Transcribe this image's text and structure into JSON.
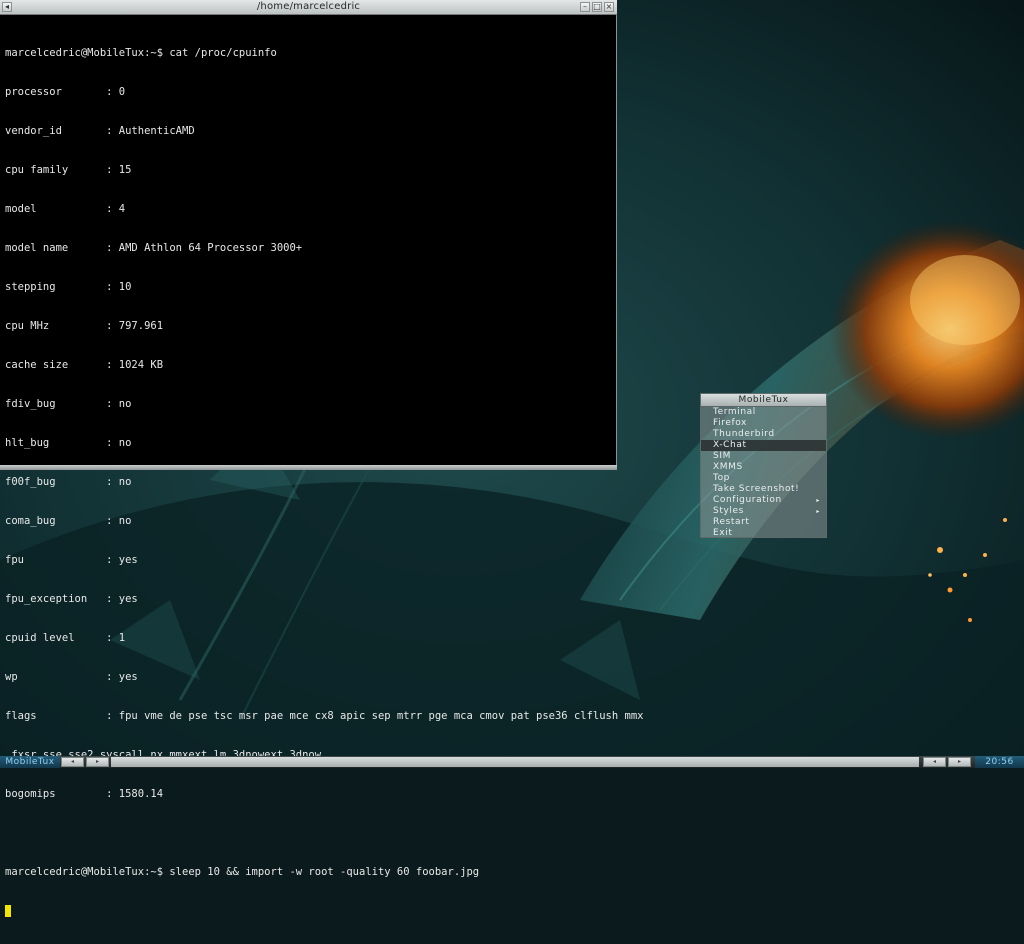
{
  "terminal": {
    "title": "/home/marcelcedric",
    "lines": [
      "marcelcedric@MobileTux:~$ cat /proc/cpuinfo",
      "processor       : 0",
      "vendor_id       : AuthenticAMD",
      "cpu family      : 15",
      "model           : 4",
      "model name      : AMD Athlon 64 Processor 3000+",
      "stepping        : 10",
      "cpu MHz         : 797.961",
      "cache size      : 1024 KB",
      "fdiv_bug        : no",
      "hlt_bug         : no",
      "f00f_bug        : no",
      "coma_bug        : no",
      "fpu             : yes",
      "fpu_exception   : yes",
      "cpuid level     : 1",
      "wp              : yes",
      "flags           : fpu vme de pse tsc msr pae mce cx8 apic sep mtrr pge mca cmov pat pse36 clflush mmx",
      " fxsr sse sse2 syscall nx mmxext lm 3dnowext 3dnow",
      "bogomips        : 1580.14",
      "",
      "marcelcedric@MobileTux:~$ sleep 10 && import -w root -quality 60 foobar.jpg"
    ],
    "cursor_color": "#f4e600"
  },
  "root_menu": {
    "title": "MobileTux",
    "items": [
      {
        "label": "Terminal",
        "submenu": false
      },
      {
        "label": "Firefox",
        "submenu": false
      },
      {
        "label": "Thunderbird",
        "submenu": false
      },
      {
        "label": "X-Chat",
        "submenu": false,
        "active": true
      },
      {
        "label": "SIM",
        "submenu": false
      },
      {
        "label": "XMMS",
        "submenu": false
      },
      {
        "label": "Top",
        "submenu": false
      },
      {
        "label": "Take Screenshot!",
        "submenu": false
      },
      {
        "label": "Configuration",
        "submenu": true
      },
      {
        "label": "Styles",
        "submenu": true
      },
      {
        "label": "Restart",
        "submenu": false
      },
      {
        "label": "Exit",
        "submenu": false
      }
    ]
  },
  "panel": {
    "workspace_name": "MobileTux",
    "clock": "20:56",
    "accent_color": "#8fd2f2"
  },
  "icons": {
    "titlebar_left": "window-menu-icon",
    "titlebar_right": [
      "minimize-icon",
      "maximize-icon",
      "close-icon"
    ],
    "menu_submenu": "submenu-arrow-icon",
    "panel_nav": [
      "prev-workspace-icon",
      "next-workspace-icon",
      "prev-window-icon",
      "next-window-icon"
    ]
  }
}
